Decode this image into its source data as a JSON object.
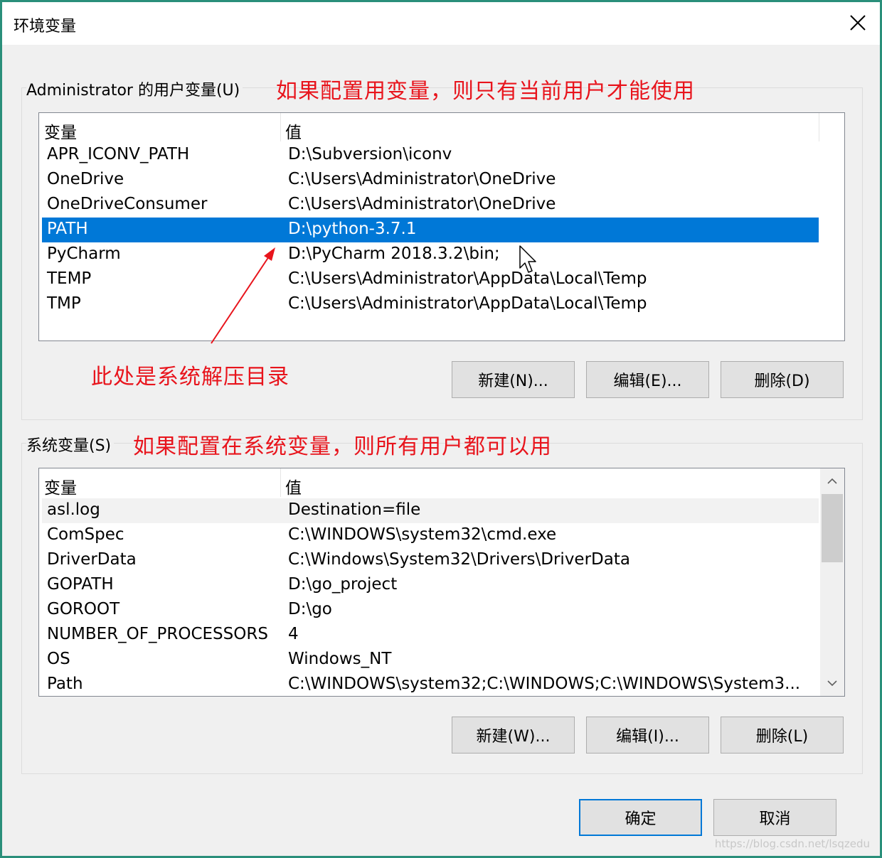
{
  "window": {
    "title": "环境变量"
  },
  "user_vars": {
    "label": "Administrator 的用户变量(U)",
    "columns": [
      "变量",
      "值"
    ],
    "rows": [
      {
        "name": "APR_ICONV_PATH",
        "value": "D:\\Subversion\\iconv"
      },
      {
        "name": "OneDrive",
        "value": "C:\\Users\\Administrator\\OneDrive"
      },
      {
        "name": "OneDriveConsumer",
        "value": "C:\\Users\\Administrator\\OneDrive"
      },
      {
        "name": "PATH",
        "value": "D:\\python-3.7.1"
      },
      {
        "name": "PyCharm",
        "value": "D:\\PyCharm 2018.3.2\\bin;"
      },
      {
        "name": "TEMP",
        "value": "C:\\Users\\Administrator\\AppData\\Local\\Temp"
      },
      {
        "name": "TMP",
        "value": "C:\\Users\\Administrator\\AppData\\Local\\Temp"
      }
    ],
    "selected": "PATH",
    "buttons": {
      "new": "新建(N)...",
      "edit": "编辑(E)...",
      "delete": "删除(D)"
    }
  },
  "system_vars": {
    "label": "系统变量(S)",
    "columns": [
      "变量",
      "值"
    ],
    "rows": [
      {
        "name": "asl.log",
        "value": "Destination=file"
      },
      {
        "name": "ComSpec",
        "value": "C:\\WINDOWS\\system32\\cmd.exe"
      },
      {
        "name": "DriverData",
        "value": "C:\\Windows\\System32\\Drivers\\DriverData"
      },
      {
        "name": "GOPATH",
        "value": "D:\\go_project"
      },
      {
        "name": "GOROOT",
        "value": "D:\\go"
      },
      {
        "name": "NUMBER_OF_PROCESSORS",
        "value": "4"
      },
      {
        "name": "OS",
        "value": "Windows_NT"
      },
      {
        "name": "Path",
        "value": "C:\\WINDOWS\\system32;C:\\WINDOWS;C:\\WINDOWS\\System3..."
      }
    ],
    "highlighted": "asl.log",
    "buttons": {
      "new": "新建(W)...",
      "edit": "编辑(I)...",
      "delete": "删除(L)"
    }
  },
  "annotations": {
    "user_note": "如果配置用变量，则只有当前用户才能使用",
    "system_note": "如果配置在系统变量，则所有用户都可以用",
    "dir_note": "此处是系统解压目录"
  },
  "dialog_buttons": {
    "ok": "确定",
    "cancel": "取消"
  },
  "watermark": "https://blog.csdn.net/lsqzedu",
  "colors": {
    "selection": "#0078d7",
    "annotation": "#e8141c",
    "frame": "#2a8f7a"
  },
  "icons": {
    "close": "close-icon",
    "scroll_up": "chevron-up-icon",
    "scroll_down": "chevron-down-icon",
    "cursor": "mouse-pointer-icon"
  }
}
